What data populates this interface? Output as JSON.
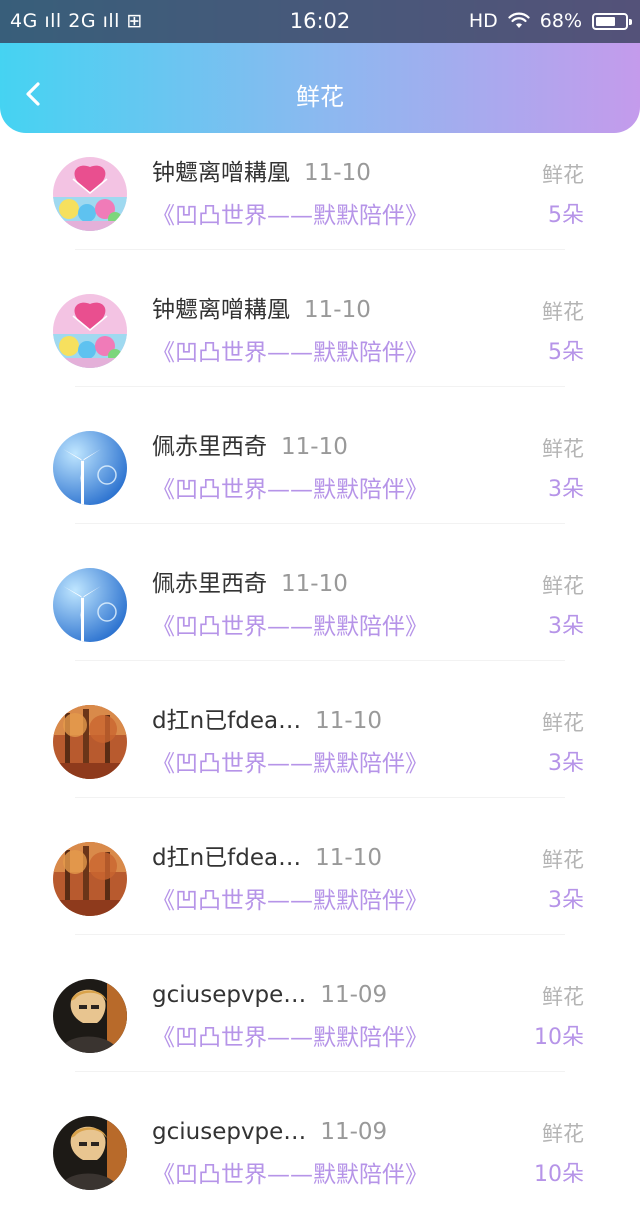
{
  "status_bar": {
    "left": "4G ıll 2G ıll ⊞",
    "time": "16:02",
    "hd": "HD",
    "battery": "68%",
    "battery_level": 0.68
  },
  "header": {
    "title": "鲜花"
  },
  "rows": [
    {
      "name": "钟魒离噌耩凰",
      "date": "11-10",
      "label": "鲜花",
      "book": "《凹凸世界——默默陪伴》",
      "count": "5朵",
      "avatar": "hearts-balloon-avatar"
    },
    {
      "name": "钟魒离噌耩凰",
      "date": "11-10",
      "label": "鲜花",
      "book": "《凹凸世界——默默陪伴》",
      "count": "5朵",
      "avatar": "hearts-balloon-avatar"
    },
    {
      "name": "佩赤里西奇",
      "date": "11-10",
      "label": "鲜花",
      "book": "《凹凸世界——默默陪伴》",
      "count": "3朵",
      "avatar": "windmill-avatar"
    },
    {
      "name": "佩赤里西奇",
      "date": "11-10",
      "label": "鲜花",
      "book": "《凹凸世界——默默陪伴》",
      "count": "3朵",
      "avatar": "windmill-avatar"
    },
    {
      "name": "d扛n已fdea…",
      "date": "11-10",
      "label": "鲜花",
      "book": "《凹凸世界——默默陪伴》",
      "count": "3朵",
      "avatar": "autumn-forest-avatar"
    },
    {
      "name": "d扛n已fdea…",
      "date": "11-10",
      "label": "鲜花",
      "book": "《凹凸世界——默默陪伴》",
      "count": "3朵",
      "avatar": "autumn-forest-avatar"
    },
    {
      "name": "gciusepvpe…",
      "date": "11-09",
      "label": "鲜花",
      "book": "《凹凸世界——默默陪伴》",
      "count": "10朵",
      "avatar": "person-portrait-avatar"
    },
    {
      "name": "gciusepvpe…",
      "date": "11-09",
      "label": "鲜花",
      "book": "《凹凸世界——默默陪伴》",
      "count": "10朵",
      "avatar": "person-portrait-avatar"
    }
  ],
  "colors": {
    "header_gradient_start": "#45d3f2",
    "header_gradient_end": "#c49bec",
    "accent_purple": "#b694e8",
    "name_text": "#333333",
    "muted_text": "#999999"
  }
}
